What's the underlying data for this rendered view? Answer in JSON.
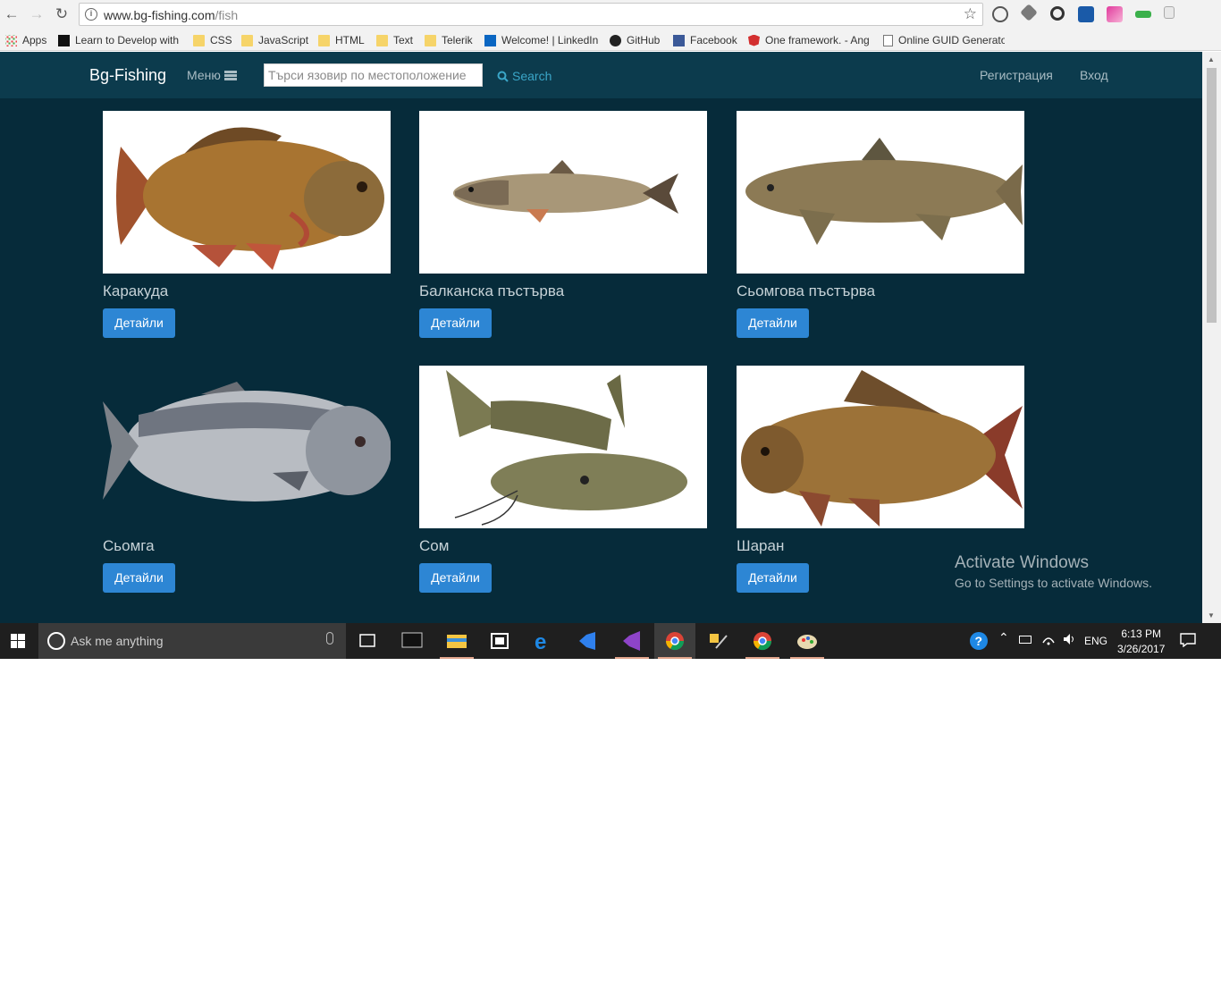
{
  "browser": {
    "url_host": "www.bg-fishing.com",
    "url_path": "/fish",
    "bookmarks": [
      {
        "label": "Apps",
        "icon": "apps-grid-icon"
      },
      {
        "label": "Learn to Develop with",
        "icon": "m-logo-icon"
      },
      {
        "label": "CSS",
        "icon": "folder-icon"
      },
      {
        "label": "JavaScript",
        "icon": "folder-icon"
      },
      {
        "label": "HTML",
        "icon": "folder-icon"
      },
      {
        "label": "Text",
        "icon": "folder-icon"
      },
      {
        "label": "Telerik",
        "icon": "folder-icon"
      },
      {
        "label": "Welcome! | LinkedIn",
        "icon": "linkedin-icon"
      },
      {
        "label": "GitHub",
        "icon": "github-icon"
      },
      {
        "label": "Facebook",
        "icon": "facebook-icon"
      },
      {
        "label": "One framework. - Ang",
        "icon": "angular-icon"
      },
      {
        "label": "Online GUID Generato",
        "icon": "page-icon"
      }
    ]
  },
  "site": {
    "brand": "Bg-Fishing",
    "menu_label": "Меню",
    "search_placeholder": "Търси язовир по местоположение",
    "search_label": "Search",
    "register_label": "Регистрация",
    "login_label": "Вход"
  },
  "fish": [
    {
      "name": "Каракуда",
      "button": "Детайли"
    },
    {
      "name": "Балканска пъстърва",
      "button": "Детайли"
    },
    {
      "name": "Сьомгова пъстърва",
      "button": "Детайли"
    },
    {
      "name": "Сьомга",
      "button": "Детайли"
    },
    {
      "name": "Сом",
      "button": "Детайли"
    },
    {
      "name": "Шаран",
      "button": "Детайли"
    }
  ],
  "watermark": {
    "title": "Activate Windows",
    "subtitle": "Go to Settings to activate Windows."
  },
  "taskbar": {
    "search_placeholder": "Ask me anything",
    "language": "ENG",
    "time": "6:13 PM",
    "date": "3/26/2017"
  },
  "colors": {
    "page_bg": "#062b3a",
    "nav_bg": "#0c3b4d",
    "button": "#2d86d4",
    "search_accent": "#3aa6c8"
  }
}
